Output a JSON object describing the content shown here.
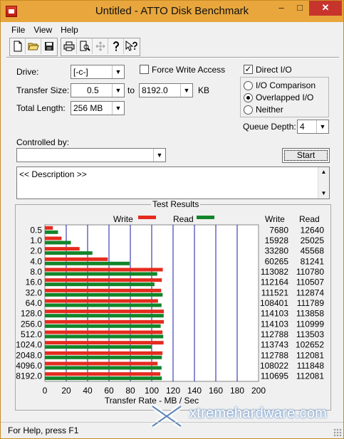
{
  "window": {
    "title": "Untitled - ATTO Disk Benchmark",
    "minimize": "–",
    "maximize": "□",
    "close": "✕"
  },
  "menu": [
    "File",
    "View",
    "Help"
  ],
  "toolbar": {
    "icons": [
      "new-document",
      "open-folder",
      "save",
      "print",
      "print-preview",
      "move",
      "help",
      "context-help"
    ]
  },
  "settings": {
    "drive_label": "Drive:",
    "drive_value": "[-c-]",
    "transfer_size_label": "Transfer Size:",
    "transfer_from": "0.5",
    "transfer_to_label": "to",
    "transfer_to": "8192.0",
    "transfer_unit": "KB",
    "total_length_label": "Total Length:",
    "total_length": "256 MB",
    "force_write_label": "Force Write Access",
    "force_write_checked": false,
    "direct_io_label": "Direct I/O",
    "direct_io_checked": true,
    "io_comparison_label": "I/O Comparison",
    "overlapped_io_label": "Overlapped I/O",
    "neither_label": "Neither",
    "selected_mode": "Overlapped I/O",
    "queue_depth_label": "Queue Depth:",
    "queue_depth": "4",
    "controlled_by_label": "Controlled by:",
    "controlled_by_value": "",
    "start_label": "Start"
  },
  "description": "<< Description >>",
  "results": {
    "title": "Test Results",
    "write_legend": "Write",
    "read_legend": "Read",
    "write_header": "Write",
    "read_header": "Read",
    "x_axis_label": "Transfer Rate - MB / Sec"
  },
  "chart_data": {
    "type": "bar",
    "orientation": "horizontal",
    "title": "Test Results",
    "xlabel": "Transfer Rate - MB / Sec",
    "ylabel": "",
    "xlim": [
      0,
      200
    ],
    "x_ticks": [
      "0",
      "20",
      "40",
      "60",
      "80",
      "100",
      "120",
      "140",
      "160",
      "180",
      "200"
    ],
    "categories": [
      "0.5",
      "1.0",
      "2.0",
      "4.0",
      "8.0",
      "16.0",
      "32.0",
      "64.0",
      "128.0",
      "256.0",
      "512.0",
      "1024.0",
      "2048.0",
      "4096.0",
      "8192.0"
    ],
    "series": [
      {
        "name": "Write",
        "color": "#e52b1e",
        "values": [
          7.5,
          15.6,
          32.5,
          58.9,
          110.4,
          109.5,
          108.9,
          105.9,
          111.4,
          111.4,
          110.1,
          111.1,
          110.1,
          105.5,
          108.1
        ]
      },
      {
        "name": "Read",
        "color": "#12852a",
        "values": [
          12.3,
          24.4,
          44.5,
          79.3,
          105.2,
          102.6,
          110.2,
          109.2,
          111.2,
          108.4,
          110.8,
          100.2,
          109.5,
          109.2,
          109.5
        ]
      }
    ],
    "table": {
      "write": [
        "7680",
        "15928",
        "33280",
        "60265",
        "113082",
        "112164",
        "111521",
        "108401",
        "114103",
        "114103",
        "112788",
        "113743",
        "112788",
        "108022",
        "110695"
      ],
      "read": [
        "12640",
        "25025",
        "45568",
        "81241",
        "110780",
        "110507",
        "112874",
        "111789",
        "113858",
        "110999",
        "113503",
        "102652",
        "112081",
        "111848",
        "112081"
      ]
    }
  },
  "status": "For Help, press F1",
  "watermark": "xtremehardware.com"
}
